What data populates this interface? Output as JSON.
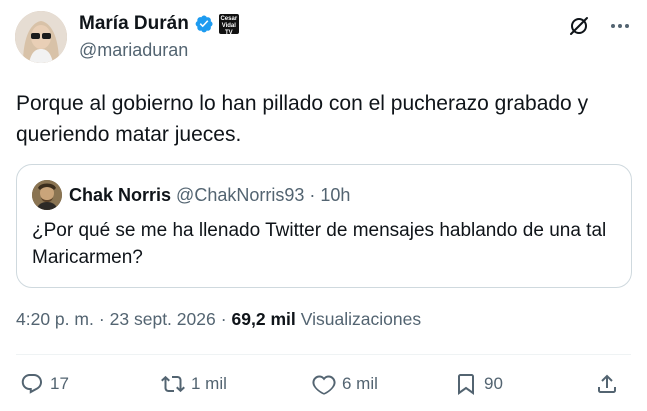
{
  "author": {
    "name": "María Durán",
    "handle": "@mariaduran",
    "affiliate_badge_text": "Cesar Vidal TV",
    "verified_color": "#1d9bf0"
  },
  "tweet": {
    "text": "Porque al gobierno lo han pillado con el pucherazo grabado y queriendo matar jueces."
  },
  "quote": {
    "name": "Chak Norris",
    "handle": "@ChakNorris93",
    "separator": "·",
    "time": "10h",
    "text": "¿Por qué se me ha llenado Twitter de mensajes hablando de una tal Maricarmen?"
  },
  "meta": {
    "time": "4:20 p. m.",
    "sep1": "·",
    "date": "23 sept. 2026",
    "sep2": "·",
    "views_count": "69,2 mil",
    "views_label": "Visualizaciones"
  },
  "actions": {
    "replies": "17",
    "retweets": "1 mil",
    "likes": "6 mil",
    "bookmarks": "90"
  },
  "icons": {
    "grok": "grok-icon",
    "more": "more-icon",
    "reply": "reply-icon",
    "retweet": "retweet-icon",
    "like": "heart-icon",
    "bookmark": "bookmark-icon",
    "share": "share-icon"
  }
}
